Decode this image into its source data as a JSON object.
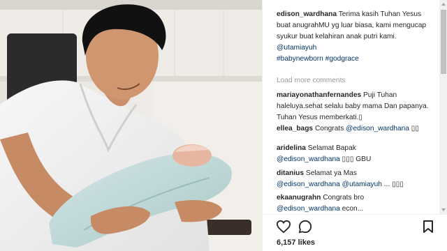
{
  "post": {
    "caption": {
      "user": "edison_wardhana",
      "text": "Terima kasih Tuhan Yesus buat anugrahMU yg luar biasa, kami mengucap syukur buat kelahiran anak putri kami.",
      "mention": "@utamiayuh",
      "hashtags": "#babynewborn #godgrace"
    },
    "load_more": "Load more comments",
    "comments": [
      {
        "user": "mariayonathanfernandes",
        "text": "Puji Tuhan haleluya.sehat selalu baby mama Dan papanya. Tuhan Yesus memberkati.▯"
      },
      {
        "user": "ellea_bags",
        "text": "Congrats",
        "mention": "@edison_wardhana",
        "suffix": "▯▯"
      },
      {
        "user": "aridelina",
        "text": "Selamat Bapak",
        "mention": "@edison_wardhana",
        "suffix": "▯▯▯ GBU"
      },
      {
        "user": "ditanius",
        "text": "Selamat ya Mas",
        "mention": "@edison_wardhana @utamiayuh",
        "suffix": "... ▯▯▯"
      },
      {
        "user": "ekaanugrahn",
        "text": "Congrats bro",
        "mention": "@edison_wardhana",
        "suffix": "econ..."
      }
    ],
    "likes": "6,157 likes"
  },
  "icons": [
    "heart-icon",
    "comment-icon",
    "bookmark-icon"
  ],
  "colors": {
    "mention": "#003569",
    "muted": "#999999",
    "text": "#262626"
  }
}
